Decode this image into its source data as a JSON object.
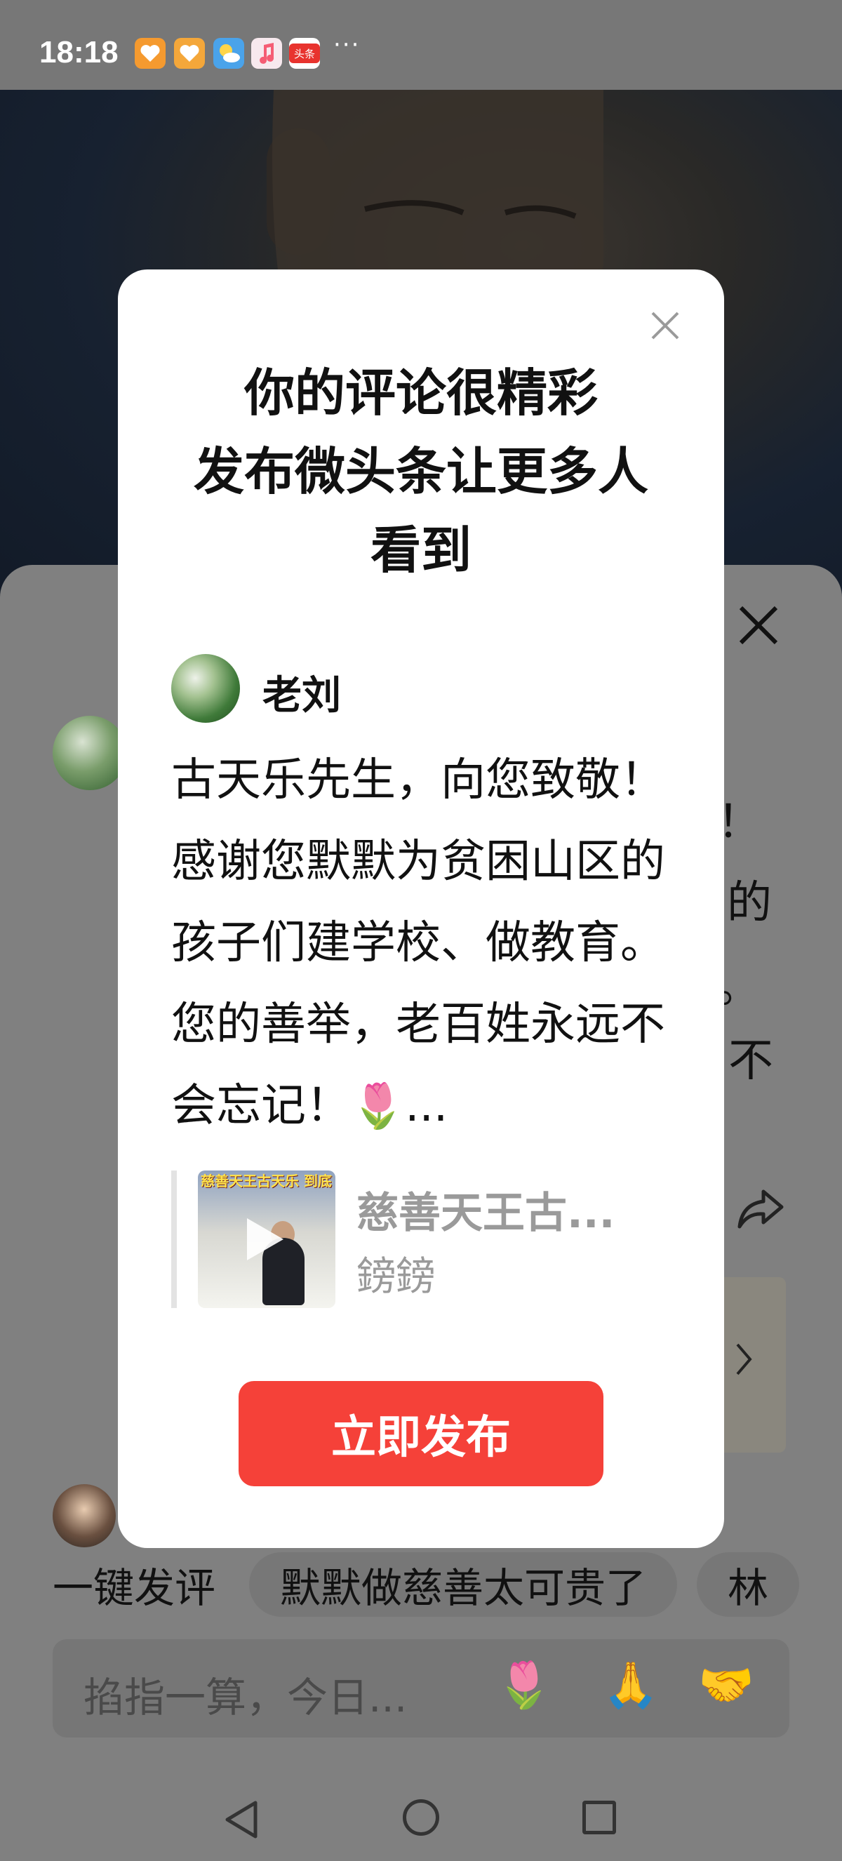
{
  "status_bar": {
    "time": "18:18",
    "more": "···",
    "icons": [
      {
        "name": "app-heart-icon-1",
        "color": "#f59a2f"
      },
      {
        "name": "app-heart-icon-2",
        "color": "#f4a73a"
      },
      {
        "name": "weather-icon",
        "color": "#4aa3ea"
      },
      {
        "name": "music-icon",
        "color": "#f55d74"
      },
      {
        "name": "toutiao-icon",
        "color": "#e8332e",
        "text": "头条"
      }
    ]
  },
  "modal": {
    "title_line1": "你的评论很精彩",
    "title_line2": "发布微头条让更多人",
    "title_line3": "看到",
    "author": "老刘",
    "comment": "古天乐先生，向您致敬！感谢您默默为贫困山区的孩子们建学校、做教育。您的善举，老百姓永远不会忘记！",
    "comment_emoji": "🌷",
    "comment_ellipsis": "...",
    "quote": {
      "thumbnail_caption": "慈善天王古天乐 到底捐建了多少所学校",
      "title": "慈善天王古...",
      "author": "鎊鎊"
    },
    "publish_label": "立即发布"
  },
  "sheet": {
    "fragments": [
      "！",
      "的",
      "。",
      "不"
    ],
    "quick_label": "一键发评",
    "quick_chips": [
      "默默做慈善太可贵了",
      "林"
    ],
    "input_placeholder": "掐指一算，今日...",
    "input_emojis": [
      "🌷",
      "🙏",
      "🤝"
    ]
  },
  "colors": {
    "accent": "#f54139",
    "overlay": "#808080"
  }
}
